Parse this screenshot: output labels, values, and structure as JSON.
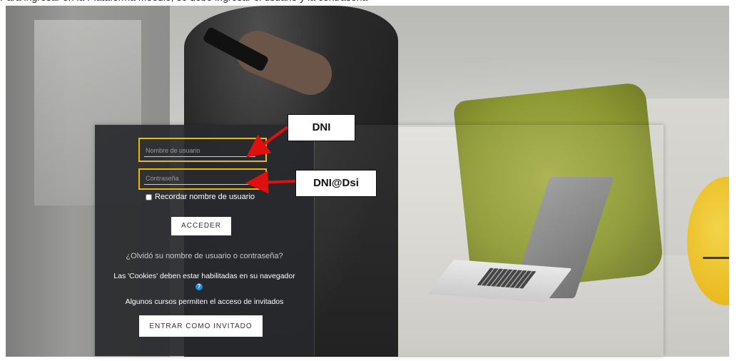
{
  "page": {
    "top_caption": "Para ingresar en la Plataforma Moodle, se debe ingresar el usuario y la contraseña"
  },
  "login": {
    "username_placeholder": "Nombre de usuario",
    "password_placeholder": "Contraseña",
    "remember_label": "Recordar nombre de usuario",
    "login_button": "ACCEDER",
    "forgot_link": "¿Olvidó su nombre de usuario o contraseña?",
    "cookies_notice": "Las 'Cookies' deben estar habilitadas en su navegador",
    "help_icon_glyph": "?",
    "guests_notice": "Algunos cursos permiten el acceso de invitados",
    "guest_button": "ENTRAR COMO INVITADO"
  },
  "annotations": {
    "username_callout": "DNI",
    "password_callout": "DNI@Dsi",
    "highlight_color": "#f0b800",
    "arrow_color": "#e01010"
  },
  "colors": {
    "form_background": "#28292d",
    "button_background": "#ffffff",
    "help_icon": "#1a8fe0"
  }
}
